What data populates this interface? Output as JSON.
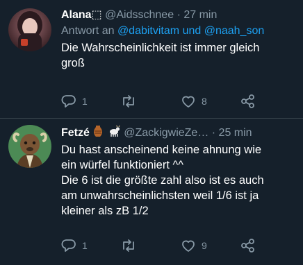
{
  "tweets": [
    {
      "name": "Alana⬚",
      "handle": "@Aidsschnee",
      "sep": "·",
      "time": "27 min",
      "reply_prefix": "Antwort an",
      "mention1": "@dabitvitam",
      "reply_and": "und",
      "mention2": "@naah_son",
      "text": "Die Wahrscheinlichkeit ist immer gleich\ngroß",
      "replies": "1",
      "retweets": "",
      "likes": "8",
      "avatar_colors": [
        "#7a4a52",
        "#2b1a1e"
      ]
    },
    {
      "name": "Fetzé",
      "handle": "@ZackigwieZe…",
      "sep": "·",
      "time": "25 min",
      "text": "Du hast anscheinend keine ahnung wie\nein würfel funktioniert ^^\nDie 6 ist die größte zahl also ist es auch\nam unwahrscheinlichsten weil 1/6 ist ja\nkleiner als zB 1/2",
      "replies": "1",
      "retweets": "",
      "likes": "9",
      "avatar_colors": [
        "#3f7a4a",
        "#6a4a2e"
      ]
    }
  ],
  "icons": {
    "reply": "reply-icon",
    "retweet": "retweet-icon",
    "like": "heart-icon",
    "share": "share-icon",
    "emoji1": "amphora-icon",
    "emoji2": "goat-icon"
  },
  "colors": {
    "background": "#15202b",
    "mention": "#1da1f2",
    "muted": "#8899a6",
    "divider": "#38444d"
  }
}
